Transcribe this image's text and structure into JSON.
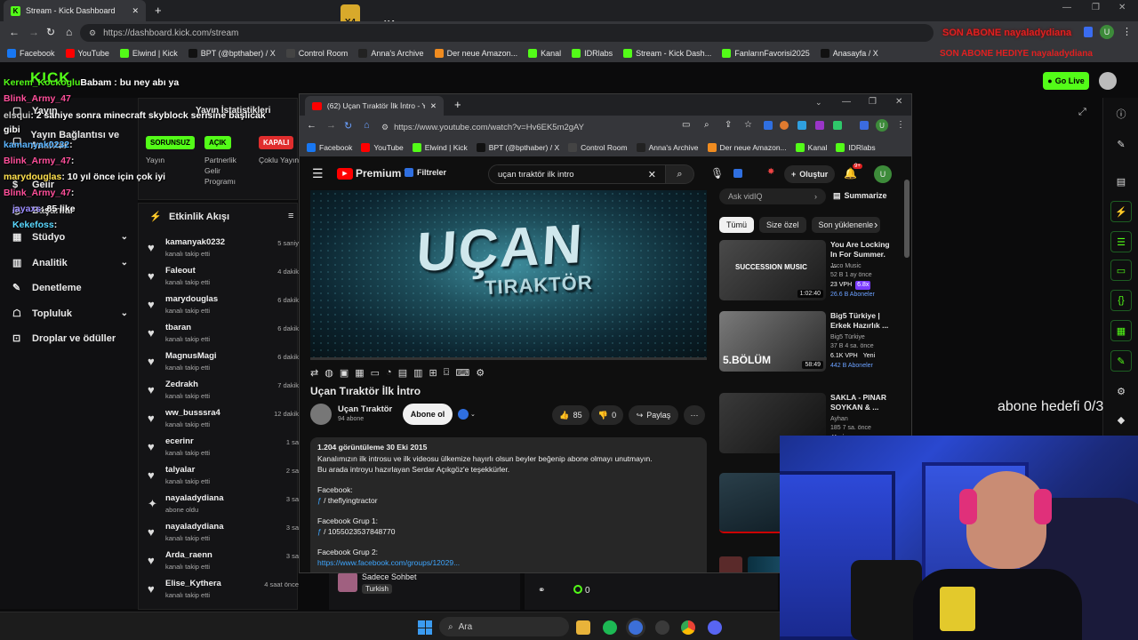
{
  "outer_browser": {
    "tab_title": "Stream - Kick Dashboard",
    "url": "https://dashboard.kick.com/stream",
    "bookmarks": [
      "Facebook",
      "YouTube",
      "Elwind | Kick",
      "BPT (@bpthaber) / X",
      "Control Room",
      "Anna's Archive",
      "Der neue Amazon...",
      "Kanal",
      "IDRlabs",
      "Stream - Kick Dash...",
      "FanlarınFavorisi2025",
      "Anasayfa / X"
    ]
  },
  "overlay": {
    "badge_left": "X4",
    "badge_right": "X4",
    "son_abone": "SON ABONE nayaladydiana",
    "son_abone_hediye": "SON ABONE HEDIYE nayaladydiana",
    "abone_hedefi": "abone hedefi 0/3"
  },
  "kick": {
    "logo": "KICK",
    "go_live": "Go Live",
    "sidebar": [
      {
        "label": "Yayın",
        "chev": false
      },
      {
        "label": "Yayın Bağlantısı ve Anahtar",
        "chev": false
      },
      {
        "label": "Gelir",
        "chev": false
      },
      {
        "label": "Başarılar",
        "chev": false
      },
      {
        "label": "Stüdyo",
        "chev": true
      },
      {
        "label": "Analitik",
        "chev": true
      },
      {
        "label": "Denetleme",
        "chev": false
      },
      {
        "label": "Topluluk",
        "chev": true
      },
      {
        "label": "Droplar ve ödüller",
        "chev": false
      }
    ],
    "stats": {
      "title": "Yayın İstatistikleri",
      "cols": [
        {
          "badge": "SORUNSUZ",
          "badge_color": "#53fc18",
          "label": "Yayın"
        },
        {
          "badge": "AÇIK",
          "badge_color": "#53fc18",
          "label": "Partnerlik Gelir Programı"
        },
        {
          "badge": "KAPALI",
          "badge_color": "#e02d2d",
          "label": "Çoklu Yayın"
        }
      ]
    },
    "activity": {
      "title": "Etkinlik Akışı",
      "items": [
        {
          "name": "kamanyak0232",
          "sub": "kanalı takip etti",
          "time": "5 saniy",
          "icon": "heart"
        },
        {
          "name": "Faleout",
          "sub": "kanalı takip etti",
          "time": "4 dakik",
          "icon": "heart"
        },
        {
          "name": "marydouglas",
          "sub": "kanalı takip etti",
          "time": "6 dakik",
          "icon": "heart"
        },
        {
          "name": "tbaran",
          "sub": "kanalı takip etti",
          "time": "6 dakik",
          "icon": "heart"
        },
        {
          "name": "MagnusMagi",
          "sub": "kanalı takip etti",
          "time": "6 dakik",
          "icon": "heart"
        },
        {
          "name": "Zedrakh",
          "sub": "kanalı takip etti",
          "time": "7 dakik",
          "icon": "heart"
        },
        {
          "name": "ww_busssra4",
          "sub": "kanalı takip etti",
          "time": "12 dakik",
          "icon": "heart"
        },
        {
          "name": "ecerinr",
          "sub": "kanalı takip etti",
          "time": "1 sa",
          "icon": "heart"
        },
        {
          "name": "talyalar",
          "sub": "kanalı takip etti",
          "time": "2 sa",
          "icon": "heart"
        },
        {
          "name": "nayaladydiana",
          "sub": "abone oldu",
          "time": "3 sa",
          "icon": "star"
        },
        {
          "name": "nayaladydiana",
          "sub": "kanalı takip etti",
          "time": "3 sa",
          "icon": "heart"
        },
        {
          "name": "Arda_raenn",
          "sub": "kanalı takip etti",
          "time": "3 sa",
          "icon": "heart"
        },
        {
          "name": "Elise_Kythera",
          "sub": "kanalı takip etti",
          "time": "4 saat önce",
          "icon": "heart"
        }
      ]
    },
    "stream_info": {
      "title": "Sadece Sohbet",
      "tag": "Turkish"
    },
    "viewers": "0"
  },
  "chat": [
    {
      "user": "Kerem_Kockoglu",
      "text": "Babam : bu ney abı ya",
      "color": "#53fc18"
    },
    {
      "user": "Blink_Army_47",
      "text": "",
      "color": "#ff4f9a"
    },
    {
      "user": "elsqui",
      "text": ": 2 saniye sonra minecraft skyblock serisine başlıcak gibi",
      "color": "#cfcfcf"
    },
    {
      "user": "kamanyak0232",
      "text": ":",
      "color": "#5ab4ff"
    },
    {
      "user": "Blink_Army_47",
      "text": ":",
      "color": "#ff4f9a"
    },
    {
      "user": "marydouglas",
      "text": ": 10 yıl önce için çok iyi",
      "color": "#ffe14d"
    },
    {
      "user": "Blink_Army_47",
      "text": ":",
      "color": "#ff4f9a"
    },
    {
      "user": "jayaxs",
      "text": ": 85 like",
      "color": "#9b8cff"
    },
    {
      "user": "Kekefoss",
      "text": ":",
      "color": "#5ad8ff"
    }
  ],
  "youtube": {
    "tab_title": "(62) Uçan Tıraktör İlk İntro - You",
    "url": "https://www.youtube.com/watch?v=Hv6EK5m2gAY",
    "bookmarks": [
      "Facebook",
      "YouTube",
      "Elwind | Kick",
      "BPT (@bpthaber) / X",
      "Control Room",
      "Anna's Archive",
      "Der neue Amazon...",
      "Kanal",
      "IDRlabs"
    ],
    "premium": "Premium",
    "premium_sup": "TR",
    "filters": "Filtreler",
    "search": "uçan tıraktör ilk intro",
    "create": "Oluştur",
    "notif_count": "9+",
    "video_overlay_line1": "UÇAN",
    "video_overlay_line2": "TIRAKTÖR",
    "title": "Uçan Tıraktör İlk İntro",
    "channel": "Uçan Tıraktör",
    "subs": "94 abone",
    "subscribe": "Abone ol",
    "likes": "85",
    "dislikes": "0",
    "share": "Paylaş",
    "desc": {
      "stats": "1.204 görüntüleme  30 Eki 2015",
      "line1": "Kanalımızın ilk introsu ve ilk videosu ülkemize hayırlı olsun beyler beğenip abone olmayı unutmayın.",
      "line2": "Bu arada introyu hazırlayan Serdar Açıkgöz'e teşekkürler.",
      "fb_label": "Facebook:",
      "fb_link": "/ theflyingtractor",
      "fbg1_label": "Facebook Grup 1:",
      "fbg1_link": "/ 1055023537848770",
      "fbg2_label": "Facebook Grup 2:",
      "fbg2_link": "https://www.facebook.com/groups/12029..."
    },
    "ask": "Ask vidIQ",
    "summarize": "Summarize",
    "chips": [
      "Tümü",
      "Size özel",
      "Son yüklenenle"
    ],
    "recs": [
      {
        "title": "You Are Locking In For Summer. ...",
        "channel": "Jsco Music",
        "meta": "52 B  1 ay önce",
        "vph": "23 VPH",
        "score": "6.8x",
        "subs": "26.6 B Aboneler",
        "duration": "1:02:40",
        "thumb_text": "SUCCESSION MUSIC"
      },
      {
        "title": "Big5 Türkiye | Erkek Hazırlık ...",
        "channel": "Big5 Türkiye",
        "meta": "37 B  4 sa. önce",
        "vph": "6.1K VPH",
        "score": "Yeni",
        "subs": "442 B Aboneler",
        "duration": "58:49",
        "thumb_text": "5.BÖLÜM"
      },
      {
        "title": "SAKLA - PINAR SOYKAN & ...",
        "channel": "Ayhan",
        "meta": "185  7 sa. önce",
        "vph": "",
        "score": "Yeni",
        "subs": "",
        "duration": "",
        "thumb_text": ""
      }
    ]
  },
  "taskbar": {
    "search": "Ara"
  }
}
